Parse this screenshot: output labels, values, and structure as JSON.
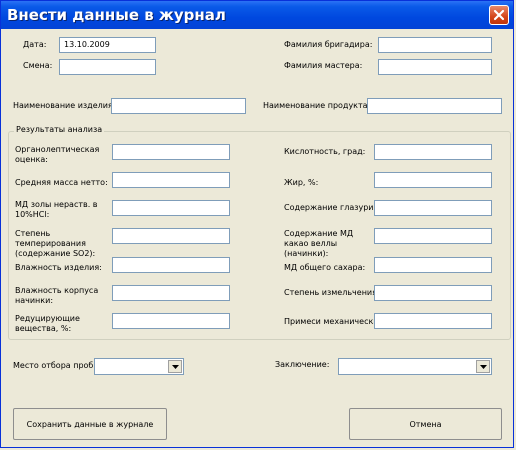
{
  "window": {
    "title": "Внести данные в журнал"
  },
  "header": {
    "date_label": "Дата:",
    "date_value": "13.10.2009",
    "shift_label": "Смена:",
    "shift_value": "",
    "brigadier_label": "Фамилия бригадира:",
    "brigadier_value": "",
    "master_label": "Фамилия мастера:",
    "master_value": "",
    "item_name_label": "Наименование изделия:",
    "item_name_value": "",
    "product_name_label": "Наименование продукта:",
    "product_name_value": ""
  },
  "analysis": {
    "group_title": "Результаты анализа",
    "left": [
      {
        "label": "Органолептическая оценка:",
        "value": ""
      },
      {
        "label": "Средняя масса нетто:",
        "value": ""
      },
      {
        "label": "МД  золы нераств. в 10%HCl:",
        "value": ""
      },
      {
        "label": "Степень темперирования (содержание SO2):",
        "value": ""
      },
      {
        "label": "Влажность изделия:",
        "value": ""
      },
      {
        "label": "Влажность корпуса начинки:",
        "value": ""
      },
      {
        "label": "Редуцирующие вещества, %:",
        "value": ""
      }
    ],
    "right": [
      {
        "label": "Кислотность,  град:",
        "value": ""
      },
      {
        "label": "Жир, %:",
        "value": ""
      },
      {
        "label": "Содержание глазури:",
        "value": ""
      },
      {
        "label": "Содержание МД какао веллы (начинки):",
        "value": ""
      },
      {
        "label": "МД общего сахара:",
        "value": ""
      },
      {
        "label": "Степень измельчения:",
        "value": ""
      },
      {
        "label": "Примеси механические:",
        "value": ""
      }
    ]
  },
  "footer": {
    "sample_place_label": "Место отбора пробы:",
    "sample_place_value": "",
    "conclusion_label": "Заключение:",
    "conclusion_value": "",
    "save_button": "Сохранить данные в журнале",
    "cancel_button": "Отмена"
  }
}
